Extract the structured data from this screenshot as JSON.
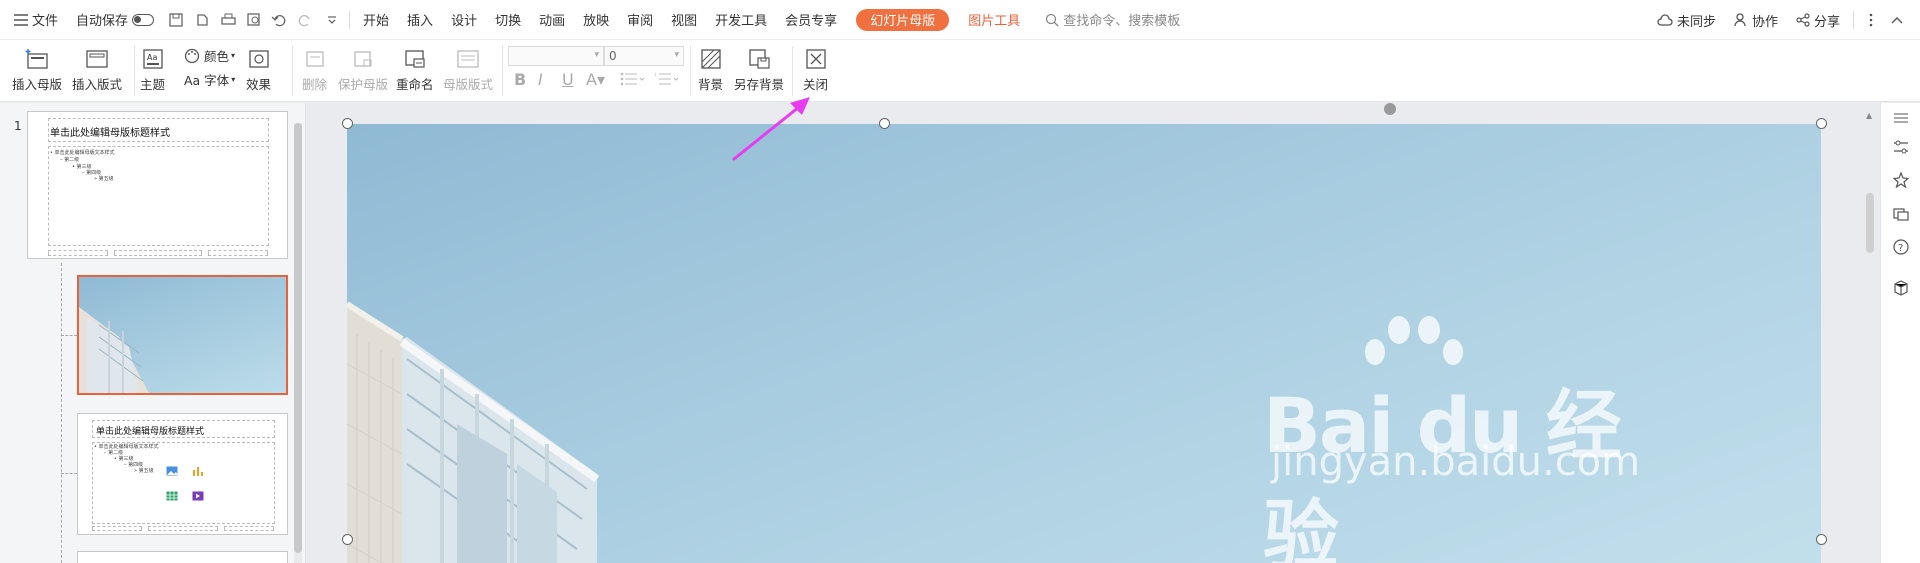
{
  "menu": {
    "file": "文件",
    "autosave": "自动保存",
    "tabs": [
      "开始",
      "插入",
      "设计",
      "切换",
      "动画",
      "放映",
      "审阅",
      "视图",
      "开发工具",
      "会员专享"
    ],
    "active_tab": "幻灯片母版",
    "picture_tools": "图片工具",
    "search_placeholder": "查找命令、搜索模板",
    "unsynced": "未同步",
    "collab": "协作",
    "share": "分享"
  },
  "ribbon": {
    "insert_master": "插入母版",
    "insert_layout": "插入版式",
    "theme": "主题",
    "colors": "颜色",
    "fonts": "Aa 字体",
    "effects": "效果",
    "delete": "删除",
    "protect_master": "保护母版",
    "rename": "重命名",
    "master_layout": "母版版式",
    "font_size": "0",
    "background": "背景",
    "save_background": "另存背景",
    "close": "关闭"
  },
  "slides": {
    "number": "1",
    "master_title": "单击此处编辑母版标题样式",
    "master_text": "• 单击此处编辑母版文本样式",
    "level2": "– 第二级",
    "level3": "• 第三级",
    "level4": "– 第四级",
    "level5": "» 第五级"
  },
  "watermark": {
    "brand": "Bai du 经验",
    "url": "jingyan.baidu.com"
  },
  "colors": {
    "accent": "#f0703f",
    "arrow": "#e83cf0"
  }
}
